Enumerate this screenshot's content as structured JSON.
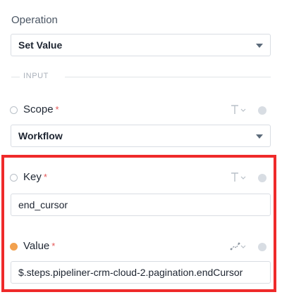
{
  "operation": {
    "label": "Operation",
    "value": "Set Value"
  },
  "section": {
    "label": "INPUT"
  },
  "scope": {
    "label": "Scope",
    "required_mark": "*",
    "value": "Workflow"
  },
  "key": {
    "label": "Key",
    "required_mark": "*",
    "value": "end_cursor"
  },
  "value_field": {
    "label": "Value",
    "required_mark": "*",
    "value": "$.steps.pipeliner-crm-cloud-2.pagination.endCursor"
  },
  "colors": {
    "accent_orange": "#f2a14e",
    "highlight_red": "#ef2a2a",
    "required_red": "#e45757"
  },
  "icons": {
    "text_type": "text-type-icon",
    "path_type": "path-type-icon",
    "chevron": "chevron-down-icon"
  }
}
